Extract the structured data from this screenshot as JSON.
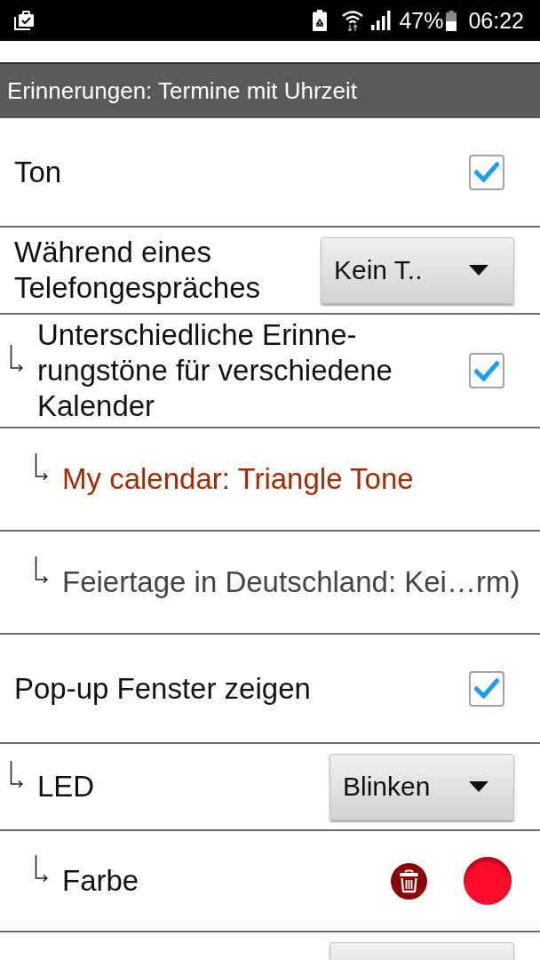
{
  "status_bar": {
    "battery": "47%",
    "time": "06:22"
  },
  "section_header": {
    "title": "Erinnerungen: Termine mit Uhrzeit"
  },
  "settings": [
    {
      "kind": "checkbox",
      "label": "Ton",
      "checked": true
    },
    {
      "kind": "dropdown",
      "label": "Während eines Telefongespräches",
      "value": "Kein T..",
      "children": [
        {
          "kind": "checkbox",
          "label": "Unterschiedliche Erinne-rungstöne für verschiedene Kalender",
          "checked": true,
          "children": [
            {
              "kind": "tone",
              "label": "My calendar: Triangle Tone",
              "color": "#a52a00"
            },
            {
              "kind": "tone",
              "label": "Feiertage in Deutschland: Kei…rm)",
              "color": "#444444"
            }
          ]
        }
      ]
    },
    {
      "kind": "checkbox",
      "label": "Pop-up Fenster zeigen",
      "checked": true,
      "children": [
        {
          "kind": "dropdown",
          "label": "LED",
          "value": "Blinken",
          "children": [
            {
              "kind": "color",
              "label": "Farbe",
              "color": "#ff0a2a"
            }
          ]
        },
        {
          "kind": "dropdown"
        }
      ]
    }
  ]
}
